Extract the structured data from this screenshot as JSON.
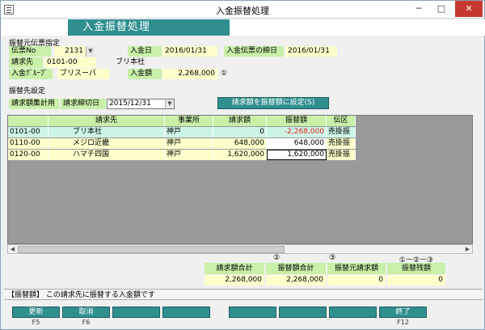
{
  "window": {
    "title": "入金振替処理",
    "minimize": "─",
    "maximize": "□",
    "close": "✕"
  },
  "header": {
    "title": "入金振替処理"
  },
  "source_section": {
    "heading": "振替元伝票指定",
    "slip_no_label": "伝票No",
    "slip_no_value": "2131",
    "deposit_date_label": "入金日",
    "deposit_date_value": "2016/01/31",
    "closing_date_label": "入金伝票の締日",
    "closing_date_value": "2016/01/31",
    "billing_label": "請求先",
    "billing_code": "0101-00",
    "billing_name": "ブリ本社",
    "group_label": "入金ｸﾞﾙｰﾌﾟ",
    "group_value": "ブリスーパ",
    "amount_label": "入金額",
    "amount_value": "2,268,000",
    "amount_mark": "①"
  },
  "dest_section": {
    "heading": "振替先設定",
    "aggregate_label": "請求額集計用",
    "closing_label": "請求締切日",
    "closing_value": "2015/12/31",
    "assign_button": "請求額を振替額に設定(S)"
  },
  "grid": {
    "headers": {
      "code": "",
      "name": "請求先",
      "office": "事業所",
      "billed": "請求額",
      "transfer": "振替額",
      "category": "伝区"
    },
    "rows": [
      {
        "code": "0101-00",
        "name": "ブリ本社",
        "office": "神戸",
        "billed": "0",
        "transfer": "-2,268,000",
        "category": "売掛振"
      },
      {
        "code": "0110-00",
        "name": "メジロ近畿",
        "office": "神戸",
        "billed": "648,000",
        "transfer": "648,000",
        "category": "売掛振"
      },
      {
        "code": "0120-00",
        "name": "ハマチ四国",
        "office": "神戸",
        "billed": "1,620,000",
        "transfer": "1,620,000",
        "category": "売掛振"
      }
    ],
    "negative_color": "#e02020"
  },
  "summary": {
    "mark2": "②",
    "mark3": "③",
    "mark_formula": "①－②－③",
    "billed_total_label": "請求額合計",
    "billed_total_value": "2,268,000",
    "transfer_total_label": "振替額合計",
    "transfer_total_value": "2,268,000",
    "source_billed_label": "振替元請求額",
    "source_billed_value": "0",
    "remaining_label": "振替残額",
    "remaining_value": "0"
  },
  "status": {
    "text": "【振替額】 この請求先に振替する入金額です"
  },
  "fkeys": [
    {
      "label": "更新",
      "key": "F5"
    },
    {
      "label": "取消",
      "key": "F6"
    },
    {
      "label": "",
      "key": ""
    },
    {
      "label": "",
      "key": ""
    },
    {
      "label": "",
      "key": ""
    },
    {
      "label": "",
      "key": ""
    },
    {
      "label": "",
      "key": ""
    },
    {
      "label": "終了",
      "key": "F12"
    }
  ]
}
